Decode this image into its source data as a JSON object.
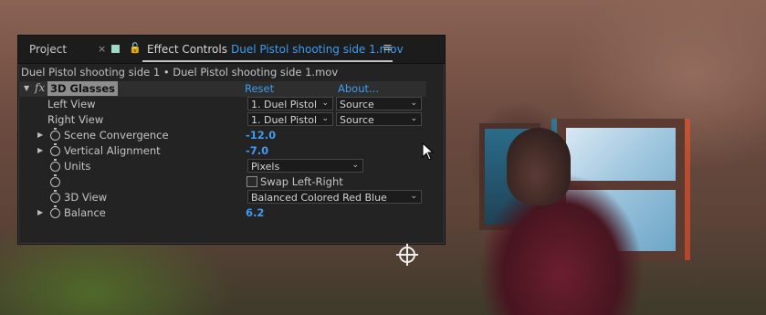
{
  "tabs": {
    "project": "Project",
    "close": "×",
    "lock": "🔓",
    "effect_controls": "Effect Controls",
    "effect_file": "Duel Pistol shooting side 1.mov",
    "menu": "≡"
  },
  "breadcrumb": "Duel Pistol shooting side 1 • Duel Pistol shooting side 1.mov",
  "effect": {
    "fx": "fx",
    "name": "3D Glasses",
    "reset": "Reset",
    "about": "About..."
  },
  "properties": {
    "left_view": {
      "label": "Left View",
      "layer": "1. Duel Pistol",
      "source": "Source"
    },
    "right_view": {
      "label": "Right View",
      "layer": "1. Duel Pistol",
      "source": "Source"
    },
    "scene_convergence": {
      "label": "Scene Convergence",
      "value": "-12.0"
    },
    "vertical_alignment": {
      "label": "Vertical Alignment",
      "value": "-7.0"
    },
    "units": {
      "label": "Units",
      "value": "Pixels"
    },
    "swap": {
      "label": "Swap Left-Right",
      "checked": false
    },
    "view_3d": {
      "label": "3D View",
      "value": "Balanced Colored Red Blue"
    },
    "balance": {
      "label": "Balance",
      "value": "6.2"
    }
  },
  "icons": {
    "triangle_open": "▼",
    "triangle_closed": "▶",
    "chevron": "⌄"
  }
}
